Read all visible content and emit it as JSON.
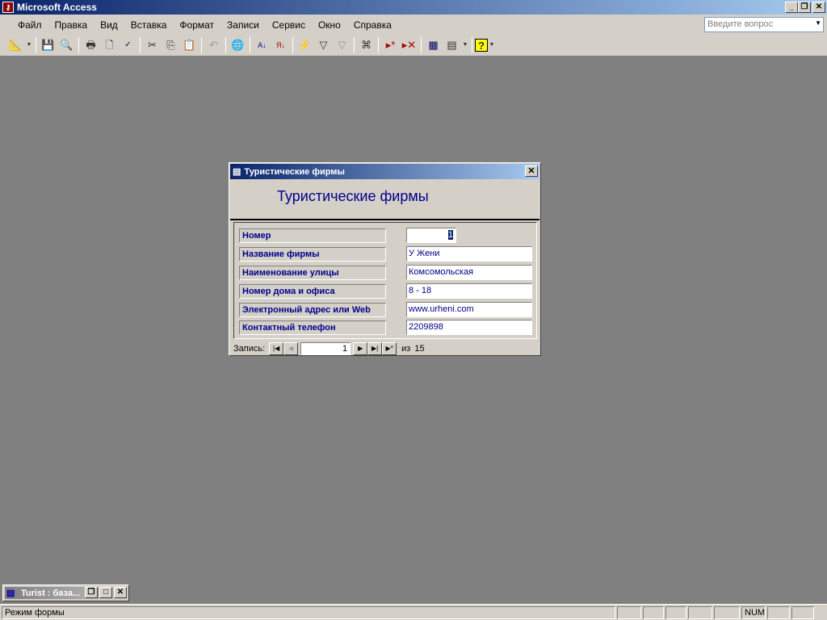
{
  "app": {
    "title": "Microsoft Access"
  },
  "menu": [
    "Файл",
    "Правка",
    "Вид",
    "Вставка",
    "Формат",
    "Записи",
    "Сервис",
    "Окно",
    "Справка"
  ],
  "ask_placeholder": "Введите вопрос",
  "toolbar_icons": [
    "design-view",
    "save",
    "file-search",
    "print",
    "print-preview",
    "spelling",
    "cut",
    "copy",
    "paste",
    "undo",
    "hyperlink",
    "sort-ascending",
    "sort-descending",
    "filter-by-selection",
    "filter-by-form",
    "apply-filter",
    "find",
    "new-record",
    "delete-record",
    "database-window",
    "new-object",
    "help"
  ],
  "form": {
    "window_title": "Туристические фирмы",
    "header": "Туристические фирмы",
    "fields": [
      {
        "label": "Номер",
        "value": "1"
      },
      {
        "label": "Название фирмы",
        "value": "У Жени"
      },
      {
        "label": "Наименование улицы",
        "value": "Комсомольская"
      },
      {
        "label": "Номер дома и офиса",
        "value": "8 - 18"
      },
      {
        "label": "Электронный адрес или Web",
        "value": "www.urheni.com"
      },
      {
        "label": "Контактный телефон",
        "value": "2209898"
      }
    ],
    "nav": {
      "label": "Запись:",
      "current": "1",
      "of": "из",
      "total": "15"
    }
  },
  "db_window": {
    "title": "Turist : база..."
  },
  "status": {
    "mode": "Режим формы",
    "num": "NUM"
  }
}
